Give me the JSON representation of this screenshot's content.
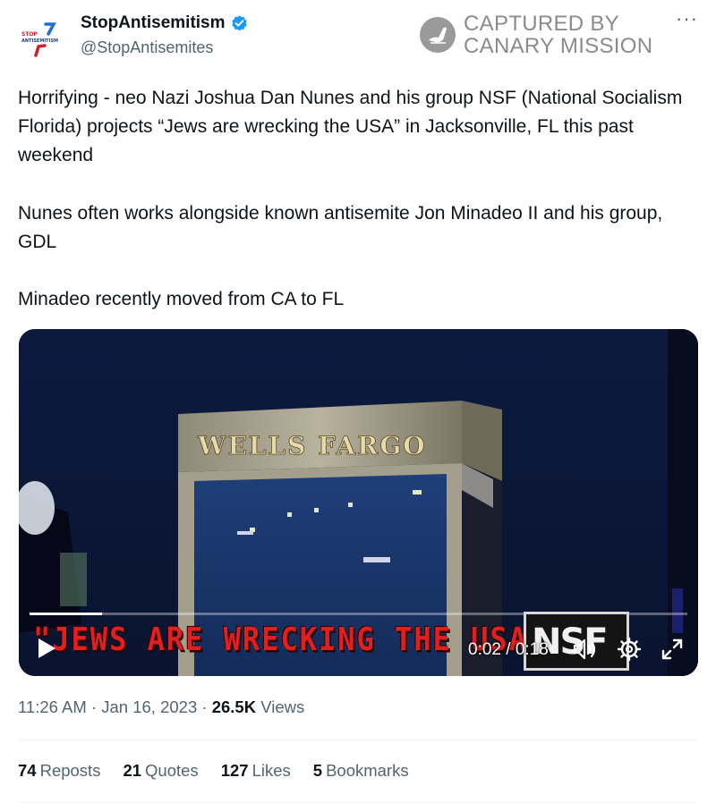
{
  "author": {
    "display_name": "StopAntisemitism",
    "handle": "@StopAntisemites",
    "avatar_text_top": "STOP",
    "avatar_text_bottom": "ANTISEMITISM"
  },
  "watermark": {
    "line1": "CAPTURED BY",
    "line2": "CANARY MISSION"
  },
  "more_label": "···",
  "tweet": {
    "paragraphs": [
      "Horrifying - neo Nazi Joshua Dan Nunes and his group NSF (National Socialism Florida) projects “Jews are wrecking the USA” in Jacksonville, FL this past weekend",
      "Nunes often works alongside known antisemite Jon Minadeo II and his group, GDL",
      "Minadeo recently moved from CA to FL"
    ]
  },
  "video": {
    "building_sign": "WELLS FARGO",
    "caption": "\"JEWS ARE WRECKING THE USA\"",
    "logo_text": "NSF",
    "current_time": "0:02",
    "duration": "0:18",
    "time_display": "0:02 / 0:18",
    "progress": 0.11
  },
  "meta": {
    "time": "11:26 AM",
    "date": "Jan 16, 2023",
    "views_count": "26.5K",
    "views_label": "Views",
    "separator": "·"
  },
  "stats": [
    {
      "count": "74",
      "label": "Reposts"
    },
    {
      "count": "21",
      "label": "Quotes"
    },
    {
      "count": "127",
      "label": "Likes"
    },
    {
      "count": "5",
      "label": "Bookmarks"
    }
  ],
  "colors": {
    "brand_blue": "#1d9bf0",
    "text": "#0f1419",
    "muted": "#536471",
    "caption_red": "#e02020"
  }
}
